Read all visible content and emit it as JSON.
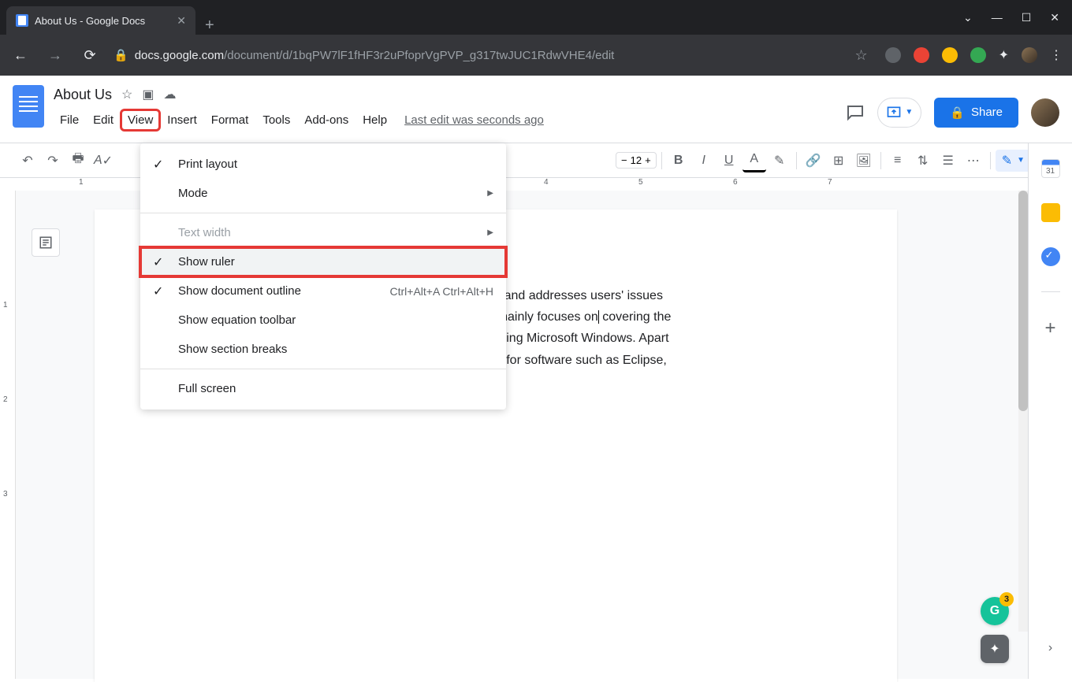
{
  "browser": {
    "tab_title": "About Us - Google Docs",
    "url_host": "docs.google.com",
    "url_path": "/document/d/1bqPW7lF1fHF3r2uPfoprVgPVP_g317twJUC1RdwVHE4/edit"
  },
  "window_controls": {
    "dropdown": "⌄",
    "minimize": "—",
    "maximize": "☐",
    "close": "✕"
  },
  "doc": {
    "title": "About Us",
    "last_edit": "Last edit was seconds ago",
    "share_label": "Share"
  },
  "menus": {
    "file": "File",
    "edit": "Edit",
    "view": "View",
    "insert": "Insert",
    "format": "Format",
    "tools": "Tools",
    "addons": "Add-ons",
    "help": "Help"
  },
  "view_menu": {
    "print_layout": "Print layout",
    "mode": "Mode",
    "text_width": "Text width",
    "show_ruler": "Show ruler",
    "show_outline": "Show document outline",
    "show_outline_shortcut": "Ctrl+Alt+A Ctrl+Alt+H",
    "show_equation": "Show equation toolbar",
    "show_section": "Show section breaks",
    "full_screen": "Full screen"
  },
  "toolbar": {
    "font_size": "12",
    "more": "⋯"
  },
  "ruler": {
    "marks": [
      "1",
      "4",
      "5",
      "6",
      "7"
    ]
  },
  "left_ruler": {
    "marks": [
      "1",
      "2",
      "3"
    ]
  },
  "page_text": "users and addresses users' issues blog mainly focuses on covering the regarding Microsoft Windows. Apart fixes for software such as Eclipse,",
  "grammarly_count": "3",
  "sidebar": {
    "calendar_day": "31"
  }
}
